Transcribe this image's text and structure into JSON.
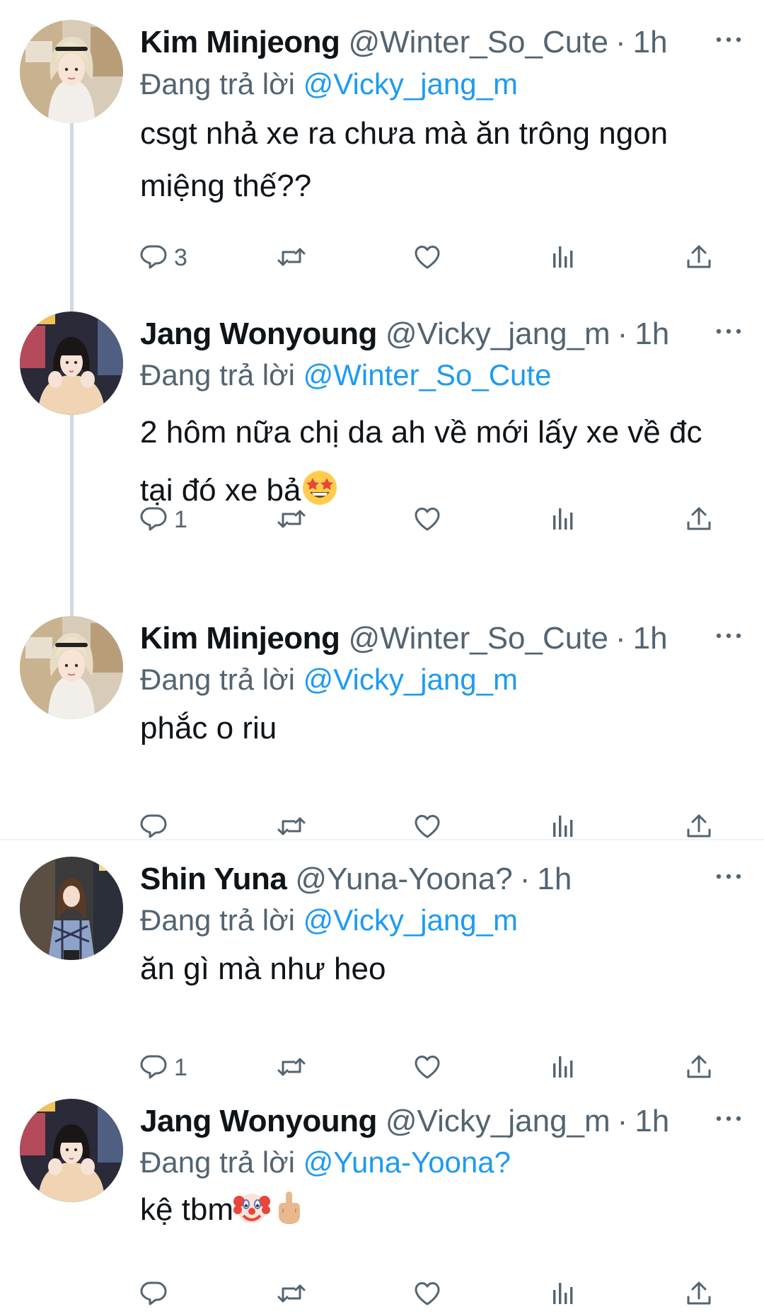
{
  "colors": {
    "text": "#0f1419",
    "secondary": "#536471",
    "link": "#1d9bf0",
    "thread_line": "#cfd9de",
    "divider": "#eff3f4"
  },
  "replying_label": "Đang trả lời",
  "tweets": [
    {
      "name": "Kim Minjeong",
      "handle": "@Winter_So_Cute",
      "sep": "·",
      "time": "1h",
      "reply_to": "@Vicky_jang_m",
      "text_lines": [
        "csgt nhả xe ra chưa mà ăn trông ngon",
        "miệng thế??"
      ],
      "reply_count": "3",
      "avatar_icon": "avatar-winter"
    },
    {
      "name": "Jang Wonyoung",
      "handle": "@Vicky_jang_m",
      "sep": "·",
      "time": "1h",
      "reply_to": "@Winter_So_Cute",
      "text_lines": [
        "2 hôm nữa chị da ah về mới lấy xe về đc",
        "tại đó xe bả"
      ],
      "emoji": "star-struck-emoji",
      "reply_count": "1",
      "avatar_icon": "avatar-wonyoung"
    },
    {
      "name": "Kim Minjeong",
      "handle": "@Winter_So_Cute",
      "sep": "·",
      "time": "1h",
      "reply_to": "@Vicky_jang_m",
      "text_lines": [
        "phắc o riu"
      ],
      "reply_count": "",
      "avatar_icon": "avatar-winter"
    },
    {
      "name": "Shin Yuna",
      "handle": "@Yuna-Yoona?",
      "sep": "·",
      "time": "1h",
      "reply_to": "@Vicky_jang_m",
      "text_lines": [
        "ăn gì mà như heo"
      ],
      "reply_count": "1",
      "avatar_icon": "avatar-yuna"
    },
    {
      "name": "Jang Wonyoung",
      "handle": "@Vicky_jang_m",
      "sep": "·",
      "time": "1h",
      "reply_to": "@Yuna-Yoona?",
      "text_lines": [
        "kệ tbm"
      ],
      "emoji": "clown-emoji middle-finger-emoji",
      "reply_count": "",
      "avatar_icon": "avatar-wonyoung"
    }
  ]
}
